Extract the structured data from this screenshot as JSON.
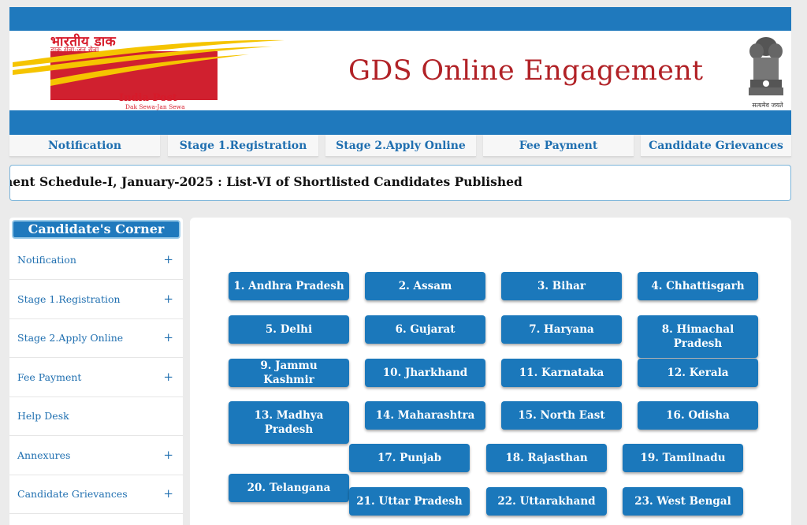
{
  "header": {
    "logo_hindi": "भारतीय डाक",
    "logo_hindi_sub": "डाक सेवा-जन सेवा",
    "logo_brand": "India Post",
    "logo_tagline": "Dak Sewa-Jan Sewa",
    "title": "GDS Online Engagement",
    "emblem_motto": "सत्यमेव जयते"
  },
  "topnav": [
    "Notification",
    "Stage 1.Registration",
    "Stage 2.Apply Online",
    "Fee Payment",
    "Candidate Grievances"
  ],
  "ticker": "nent Schedule-I, January-2025 : List-VI of Shortlisted Candidates Published",
  "sidebar": {
    "title": "Candidate's Corner",
    "items": [
      {
        "label": "Notification",
        "expand": "+"
      },
      {
        "label": "Stage 1.Registration",
        "expand": "+"
      },
      {
        "label": "Stage 2.Apply Online",
        "expand": "+"
      },
      {
        "label": "Fee Payment",
        "expand": "+"
      },
      {
        "label": "Help Desk",
        "expand": ""
      },
      {
        "label": "Annexures",
        "expand": "+"
      },
      {
        "label": "Candidate Grievances",
        "expand": "+"
      }
    ]
  },
  "states": [
    "1. Andhra Pradesh",
    "2. Assam",
    "3. Bihar",
    "4. Chhattisgarh",
    "5. Delhi",
    "6. Gujarat",
    "7. Haryana",
    "8. Himachal Pradesh",
    "9. Jammu Kashmir",
    "10. Jharkhand",
    "11. Karnataka",
    "12. Kerala",
    "13. Madhya Pradesh",
    "14. Maharashtra",
    "15. North East",
    "16. Odisha",
    "17. Punjab",
    "18. Rajasthan",
    "19. Tamilnadu",
    "20. Telangana",
    "21. Uttar Pradesh",
    "22. Uttarakhand",
    "23. West Bengal"
  ],
  "colors": {
    "primary_blue": "#1f79bd",
    "title_red": "#b12227",
    "brand_red": "#d0202f",
    "brand_yellow": "#f5c400"
  },
  "icons": {
    "logo": "india-post-logo",
    "emblem": "national-emblem",
    "expand": "plus-icon"
  }
}
